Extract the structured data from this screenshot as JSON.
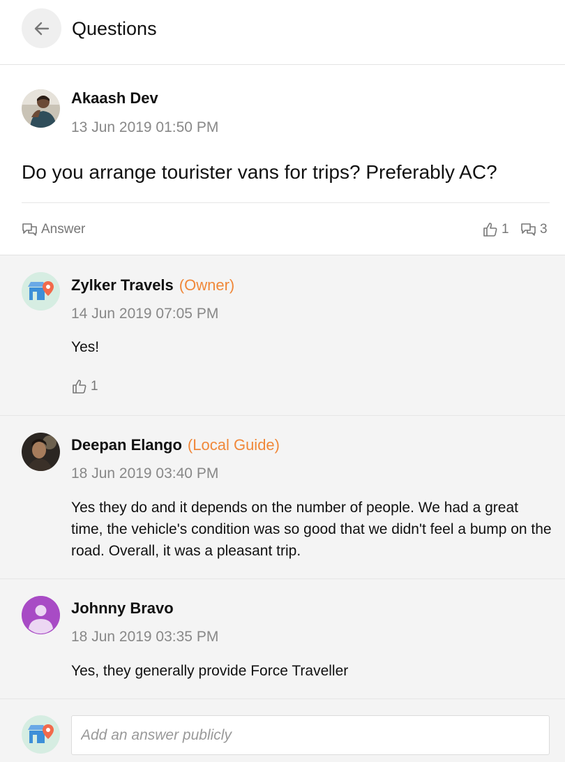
{
  "header": {
    "title": "Questions",
    "back_icon": "arrow-left-icon"
  },
  "question": {
    "author": "Akaash Dev",
    "time": "13 Jun 2019 01:50 PM",
    "text": "Do you arrange tourister vans for trips? Preferably AC?",
    "answer_label": "Answer",
    "likes": "1",
    "answers": "3"
  },
  "answers": [
    {
      "author": "Zylker Travels",
      "role": "(Owner)",
      "time": "14 Jun 2019 07:05 PM",
      "text": "Yes!",
      "likes": "1"
    },
    {
      "author": "Deepan Elango",
      "role": "(Local Guide)",
      "time": "18 Jun 2019 03:40 PM",
      "text": "Yes they do and it depends on the number of people. We had a great time, the vehicle's condition was so good that we didn't feel a bump on the road. Overall, it was a pleasant trip."
    },
    {
      "author": "Johnny Bravo",
      "time": "18 Jun 2019 03:35 PM",
      "text": "Yes, they generally provide Force Traveller"
    }
  ],
  "composer": {
    "placeholder": "Add an answer publicly"
  },
  "colors": {
    "accent": "#f0883a",
    "muted": "#888888",
    "panel": "#f4f4f4",
    "avatar_purple": "#a84bc5"
  }
}
